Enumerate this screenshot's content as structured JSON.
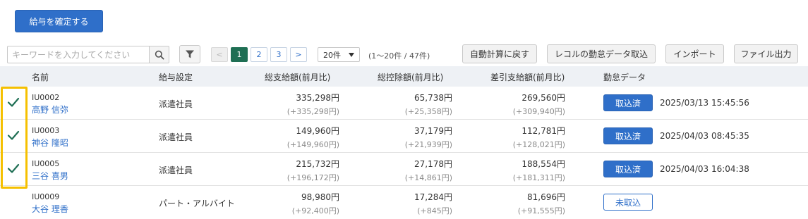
{
  "actions": {
    "confirm_label": "給与を確定する"
  },
  "search": {
    "placeholder": "キーワードを入力してください",
    "icon": "search-icon"
  },
  "filter": {
    "icon": "filter-icon"
  },
  "pagination": {
    "prev": "<",
    "pages": [
      "1",
      "2",
      "3"
    ],
    "current": "1",
    "next": ">",
    "per_page": "20件",
    "range": "(1〜20件 / 47件)"
  },
  "toolbar": {
    "auto_calc": "自動計算に戻す",
    "import_recolu": "レコルの勤怠データ取込",
    "import": "インポート",
    "file_output": "ファイル出力"
  },
  "table": {
    "headers": {
      "name": "名前",
      "setting": "給与設定",
      "gross": "総支給額(前月比)",
      "deduction": "総控除額(前月比)",
      "net": "差引支給額(前月比)",
      "attendance": "勤怠データ"
    },
    "rows": [
      {
        "checked": true,
        "code": "IU0002",
        "name": "高野 信弥",
        "setting": "派遣社員",
        "gross": "335,298円",
        "gross_diff": "(+335,298円)",
        "deduction": "65,738円",
        "deduction_diff": "(+25,358円)",
        "net": "269,560円",
        "net_diff": "(+309,940円)",
        "attendance_status": "取込済",
        "attendance_time": "2025/03/13 15:45:56"
      },
      {
        "checked": true,
        "code": "IU0003",
        "name": "神谷 隆昭",
        "setting": "派遣社員",
        "gross": "149,960円",
        "gross_diff": "(+149,960円)",
        "deduction": "37,179円",
        "deduction_diff": "(+21,939円)",
        "net": "112,781円",
        "net_diff": "(+128,021円)",
        "attendance_status": "取込済",
        "attendance_time": "2025/04/03 08:45:35"
      },
      {
        "checked": true,
        "code": "IU0005",
        "name": "三谷 喜男",
        "setting": "派遣社員",
        "gross": "215,732円",
        "gross_diff": "(+196,172円)",
        "deduction": "27,178円",
        "deduction_diff": "(+14,861円)",
        "net": "188,554円",
        "net_diff": "(+181,311円)",
        "attendance_status": "取込済",
        "attendance_time": "2025/04/03 16:04:38"
      },
      {
        "checked": false,
        "code": "IU0009",
        "name": "大谷 理香",
        "setting": "パート・アルバイト",
        "gross": "98,980円",
        "gross_diff": "(+92,400円)",
        "deduction": "17,284円",
        "deduction_diff": "(+845円)",
        "net": "81,696円",
        "net_diff": "(+91,555円)",
        "attendance_status": "未取込",
        "attendance_time": ""
      }
    ]
  },
  "colors": {
    "primary": "#2f6fc9",
    "check": "#1f6f54",
    "highlight": "#f5c000",
    "header_bg": "#eef1f5"
  }
}
